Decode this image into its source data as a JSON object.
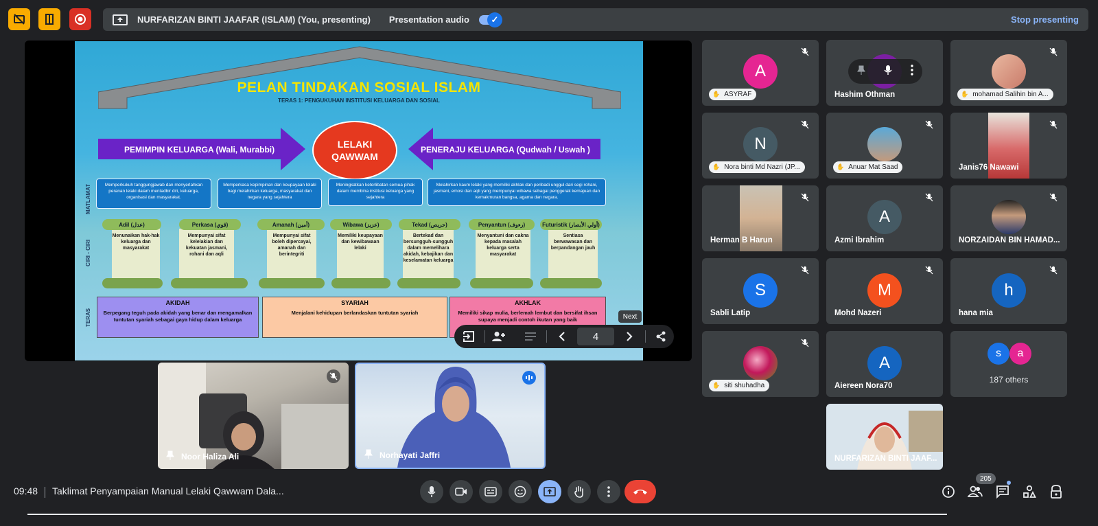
{
  "presenting_banner": {
    "text": "NURFARIZAN BINTI JAAFAR (ISLAM) (You, presenting)",
    "audio_label": "Presentation audio",
    "stop_label": "Stop presenting"
  },
  "slide": {
    "title": "PELAN TINDAKAN SOSIAL ISLAM",
    "subtitle": "TERAS 1: PENGUKUHAN INSTITUSI KELUARGA DAN SOSIAL",
    "center_oval": [
      "LELAKI",
      "QAWWAM"
    ],
    "left_arrow": "PEMIMPIN KELUARGA (Wali, Murabbi)",
    "right_arrow": "PENERAJU KELUARGA (Qudwah / Uswah )",
    "side_labels": {
      "matlamat": "MATLAMAT",
      "ciri": "CIRI - CIRI",
      "teras": "TERAS"
    },
    "matlamat": [
      "Memperkukuh tanggungjawab dan menyerlahkan peranan lelaki dalam mentadbir diri, keluarga, organisasi dan masyarakat.",
      "Memperkasa kepimpinan dan keupayaan lelaki bagi melahirkan keluarga, masyarakat dan negara yang sejahtera",
      "Meningkatkan keterlibatan semua pihak dalam membina institusi keluarga yang sejahtera",
      "Melahirkan kaum lelaki yang memiliki akhlak dan peribadi unggul dari segi rohani, jasmani, emosi dan aqli yang mempunyai wibawa sebagai penggerak kemajuan dan kemakmuran bangsa, agama dan negara."
    ],
    "ciri": [
      {
        "title": "Adil (عدل)",
        "body": "Menunaikan hak-hak keluarga dan masyarakat"
      },
      {
        "title": "Perkasa (قوي)",
        "body": "Mempunyai sifat kelelakian dan kekuatan jasmani, rohani dan aqli"
      },
      {
        "title": "Amanah (أمين)",
        "body": "Mempunyai sifat boleh dipercayai, amanah dan berintegriti"
      },
      {
        "title": "Wibawa (عزيز)",
        "body": "Memiliki keupayaan dan kewibawaan lelaki"
      },
      {
        "title": "Tekad (حريص)",
        "body": "Bertekad dan bersungguh-sungguh dalam memelihara akidah, kebajikan dan keselamatan keluarga"
      },
      {
        "title": "Penyantun (رءوف)",
        "body": "Menyantuni dan cakna kepada masalah keluarga serta masyarakat"
      },
      {
        "title": "Futuristik (أولي الأبصار)",
        "body": "Sentiasa berwawasan dan berpandangan jauh"
      }
    ],
    "teras": [
      {
        "title": "AKIDAH",
        "body": "Berpegang teguh pada akidah yang benar dan mengamalkan tuntutan syariah sebagai gaya hidup dalam keluarga",
        "color": "#9d8ff0"
      },
      {
        "title": "SYARIAH",
        "body": "Menjalani kehidupan berlandaskan tuntutan syariah",
        "color": "#fcc9a4"
      },
      {
        "title": "AKHLAK",
        "body": "Memiliki sikap mulia, berlemah lembut dan bersifat ihsan supaya menjadi contoh ikutan yang baik",
        "color": "#f27aa6"
      }
    ]
  },
  "slide_controls": {
    "tooltip": "Next",
    "page": "4"
  },
  "featured_videos": [
    {
      "name": "Noor Haliza Ali"
    },
    {
      "name": "Norhayati Jaffri"
    }
  ],
  "participants": [
    {
      "name": "ASYRAF",
      "initial": "A",
      "color": "#e52592",
      "style": "pill"
    },
    {
      "name": "Hashim Othman",
      "style": "plain"
    },
    {
      "name": "mohamad Salihin bin A...",
      "style": "pill"
    },
    {
      "name": "Nora binti Md Nazri (JP...",
      "initial": "N",
      "color": "#455a64",
      "style": "pill"
    },
    {
      "name": "Anuar Mat Saad",
      "style": "pill"
    },
    {
      "name": "Janis76 Nawawi",
      "style": "plain"
    },
    {
      "name": "Herman B Harun",
      "style": "plain"
    },
    {
      "name": "Azmi Ibrahim",
      "initial": "A",
      "color": "#455a64",
      "style": "plain"
    },
    {
      "name": "NORZAIDAN BIN HAMAD...",
      "style": "plain"
    },
    {
      "name": "Sabli Latip",
      "initial": "S",
      "color": "#1a73e8",
      "style": "plain"
    },
    {
      "name": "Mohd Nazeri",
      "initial": "M",
      "color": "#f4511e",
      "style": "plain"
    },
    {
      "name": "hana mia",
      "initial": "h",
      "color": "#1565c0",
      "style": "plain"
    },
    {
      "name": "siti shuhadha",
      "style": "pill"
    },
    {
      "name": "Aiereen Nora70",
      "initial": "A",
      "color": "#1565c0",
      "style": "plain"
    },
    {
      "name": "NURFARIZAN BINTI JAAF...",
      "style": "plain"
    }
  ],
  "others": {
    "label": "187 others",
    "initials": [
      "s",
      "a"
    ],
    "colors": [
      "#1a73e8",
      "#e52592"
    ]
  },
  "bottom_bar": {
    "time": "09:48",
    "meeting_title": "Taklimat Penyampaian Manual Lelaki Qawwam Dala...",
    "people_count": "205"
  }
}
